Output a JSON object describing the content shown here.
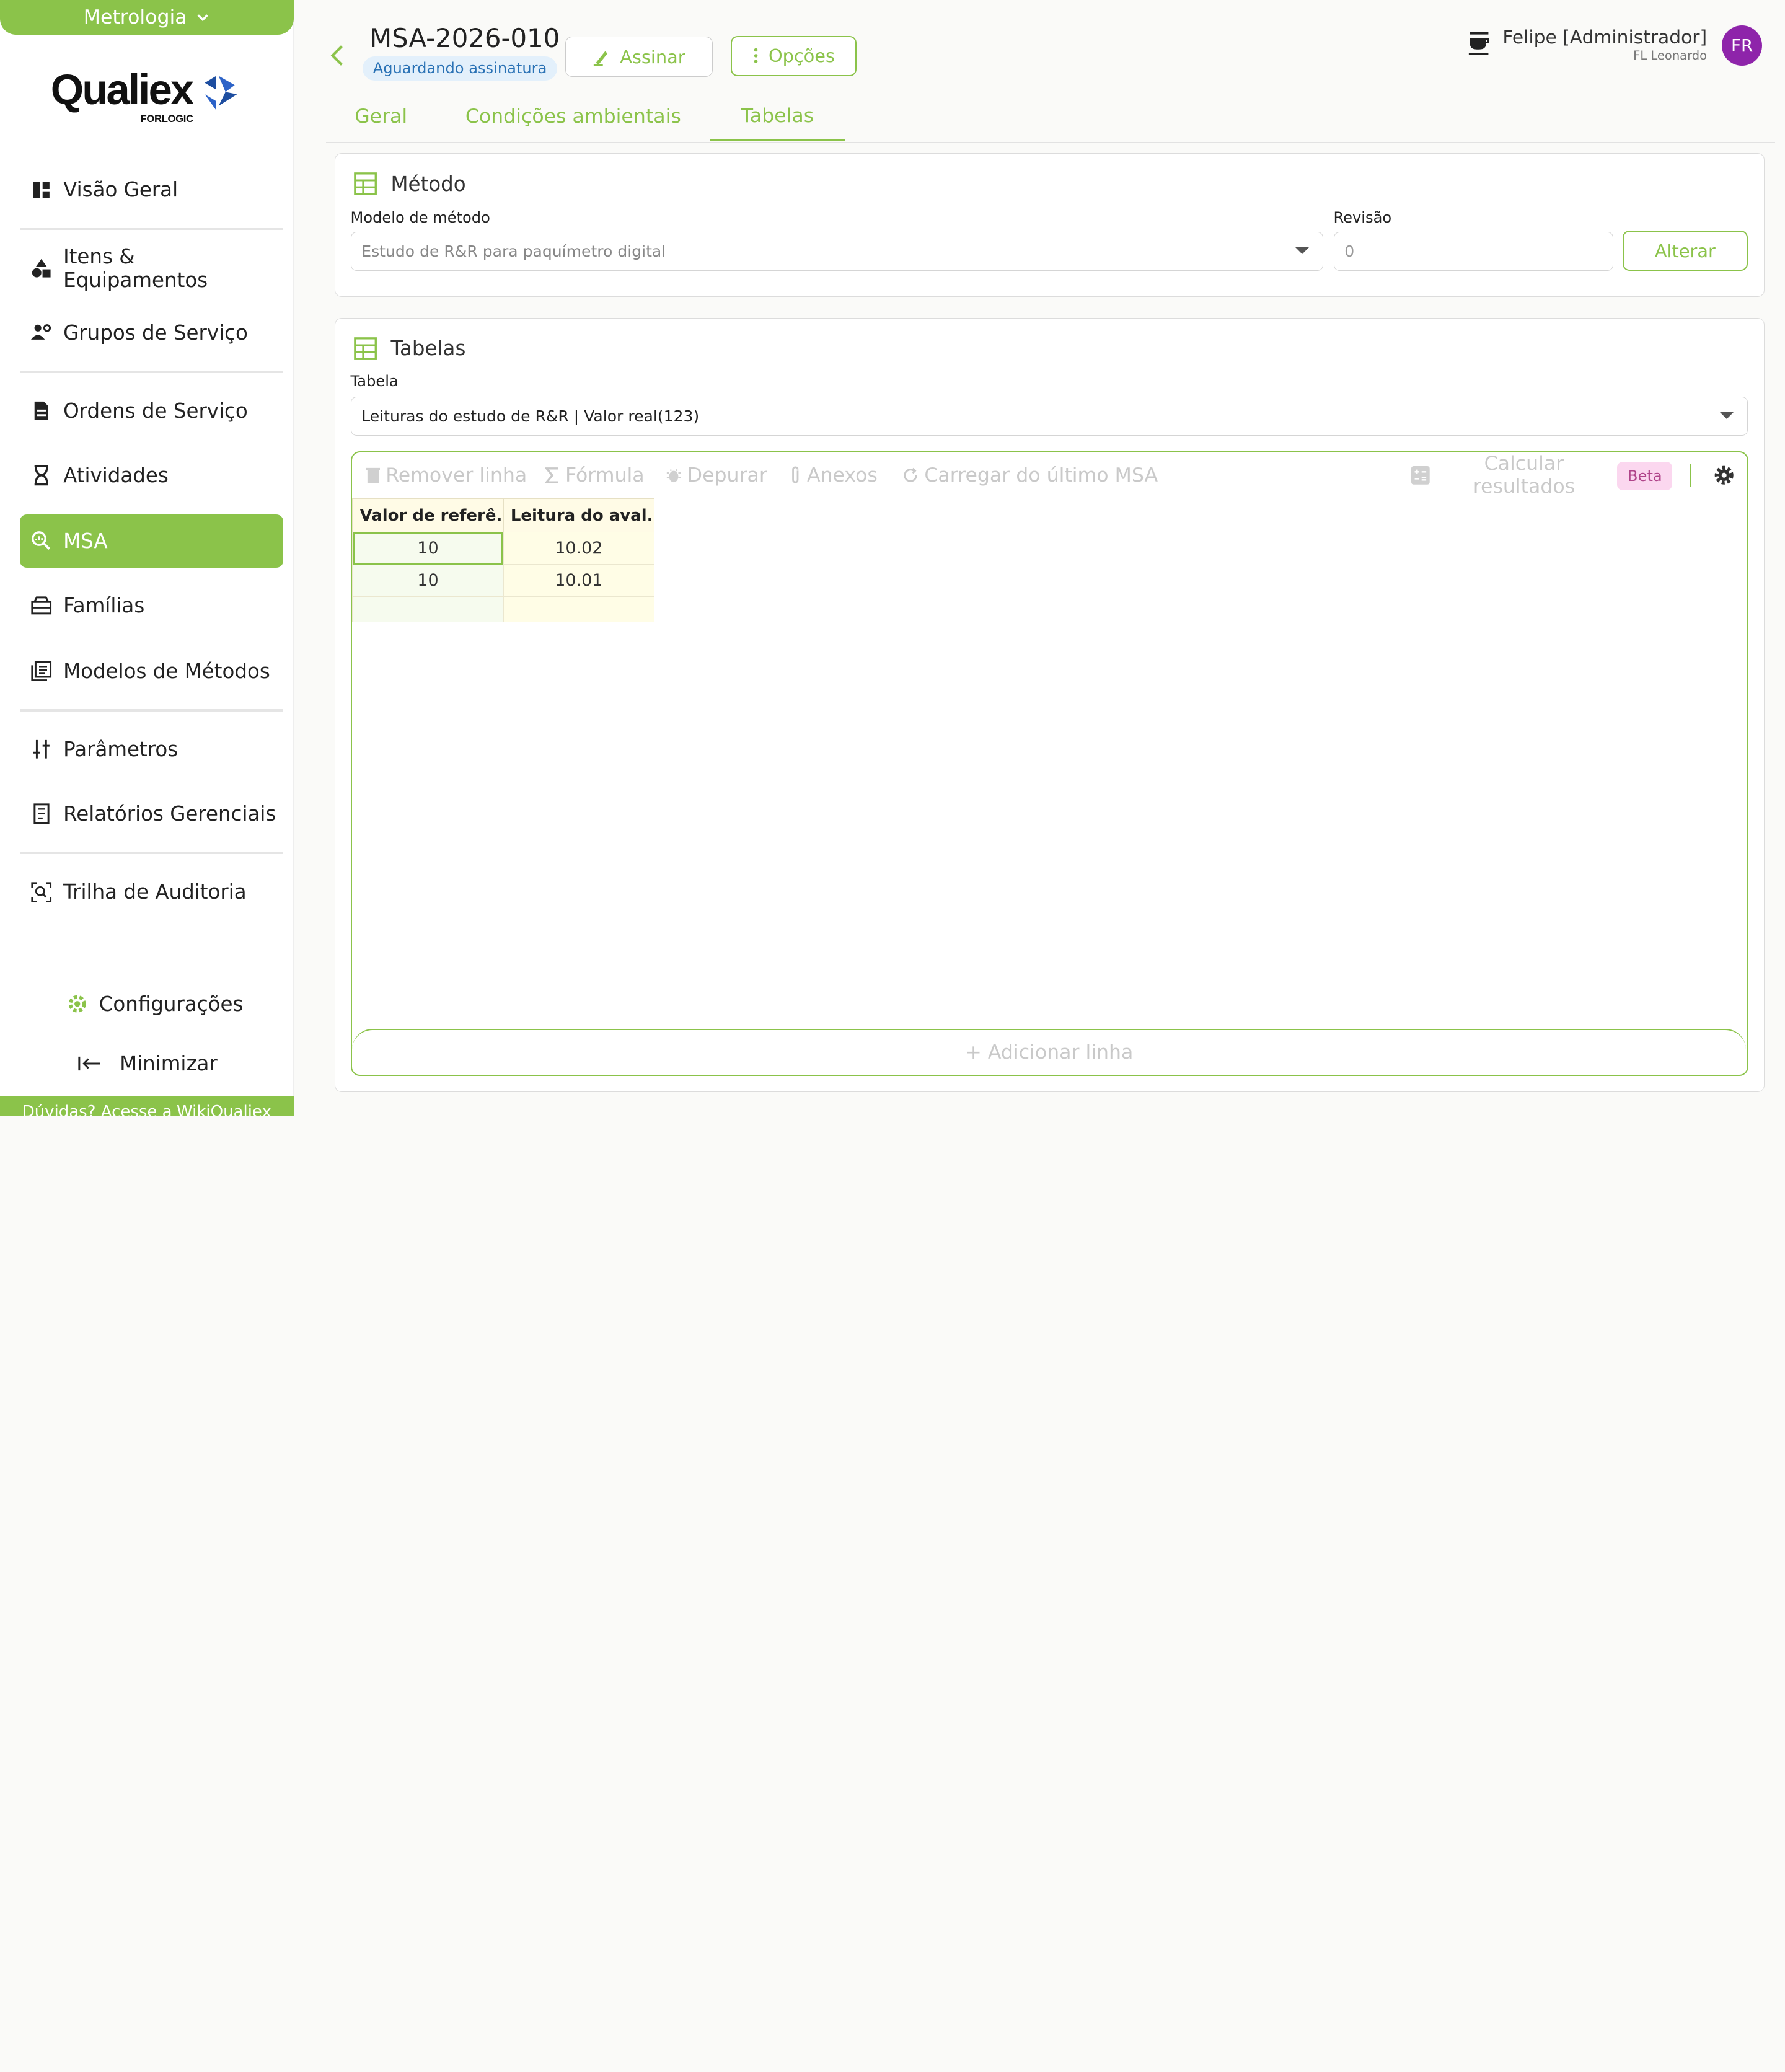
{
  "sidebar": {
    "module": "Metrologia",
    "logo": {
      "brand": "Qualiex",
      "sub": "FORLOGIC"
    },
    "items": [
      {
        "label": "Visão Geral",
        "icon": "dashboard-icon"
      },
      {
        "label": "Itens & Equipamentos",
        "icon": "shapes-icon"
      },
      {
        "label": "Grupos de Serviço",
        "icon": "group-settings-icon"
      },
      {
        "label": "Ordens de Serviço",
        "icon": "document-icon"
      },
      {
        "label": "Atividades",
        "icon": "hourglass-icon"
      },
      {
        "label": "MSA",
        "icon": "search-analytics-icon",
        "active": true
      },
      {
        "label": "Famílias",
        "icon": "box-icon"
      },
      {
        "label": "Modelos de Métodos",
        "icon": "library-icon"
      },
      {
        "label": "Parâmetros",
        "icon": "sliders-icon"
      },
      {
        "label": "Relatórios Gerenciais",
        "icon": "report-icon"
      },
      {
        "label": "Trilha de Auditoria",
        "icon": "audit-icon"
      }
    ],
    "config_label": "Configurações",
    "minimize_label": "Minimizar",
    "help_text": "Dúvidas? Acesse a",
    "help_link": "WikiQualiex"
  },
  "header": {
    "title": "MSA-2026-010",
    "status": "Aguardando assinatura",
    "sign_label": "Assinar",
    "options_label": "Opções",
    "user_name": "Felipe [Administrador]",
    "user_org": "FL Leonardo",
    "avatar_initials": "FR"
  },
  "tabs": [
    {
      "label": "Geral"
    },
    {
      "label": "Condições ambientais"
    },
    {
      "label": "Tabelas",
      "active": true
    }
  ],
  "method_card": {
    "title": "Método",
    "model_label": "Modelo de método",
    "model_value": "Estudo de R&R para paquímetro digital",
    "revision_label": "Revisão",
    "revision_value": "0",
    "change_label": "Alterar"
  },
  "tables_card": {
    "title": "Tabelas",
    "table_label": "Tabela",
    "table_value": "Leituras do estudo de R&R | Valor real(123)",
    "toolbar": {
      "remove_row": "Remover linha",
      "formula": "Fórmula",
      "debug": "Depurar",
      "attachments": "Anexos",
      "load_last": "Carregar do último MSA",
      "calc_line1": "Calcular",
      "calc_line2": "resultados",
      "beta": "Beta"
    },
    "columns": [
      "Valor de referê...",
      "Leitura do aval..."
    ],
    "rows": [
      [
        "10",
        "10.02"
      ],
      [
        "10",
        "10.01"
      ],
      [
        "",
        ""
      ]
    ],
    "add_row_label": "+ Adicionar linha"
  },
  "colors": {
    "accent": "#8bc34a",
    "badge_bg": "#e3f0fb",
    "badge_text": "#2a72b5",
    "avatar": "#8e24aa",
    "beta_bg": "#fbd7ef"
  }
}
